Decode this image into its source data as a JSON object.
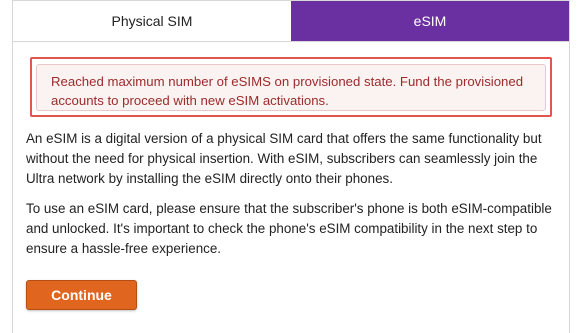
{
  "tabs": [
    {
      "label": "Physical SIM",
      "active": false
    },
    {
      "label": "eSIM",
      "active": true
    }
  ],
  "alert": {
    "message": "Reached maximum number of eSIMS on provisioned state. Fund the provisioned accounts to proceed with new eSIM activations."
  },
  "content": {
    "paragraph_1": "An eSIM is a digital version of a physical SIM card that offers the same functionality but without the need for physical insertion. With eSIM, subscribers can seamlessly join the Ultra network by installing the eSIM directly onto their phones.",
    "paragraph_2": "To use an eSIM card, please ensure that the subscriber's phone is both eSIM-compatible and unlocked. It's important to check the phone's eSIM compatibility in the next step to ensure a hassle-free experience."
  },
  "actions": {
    "continue_label": "Continue"
  },
  "colors": {
    "accent_purple": "#6a2fa0",
    "button_orange": "#e0651f",
    "alert_text": "#9c2b2b",
    "alert_highlight": "#e1564d"
  }
}
